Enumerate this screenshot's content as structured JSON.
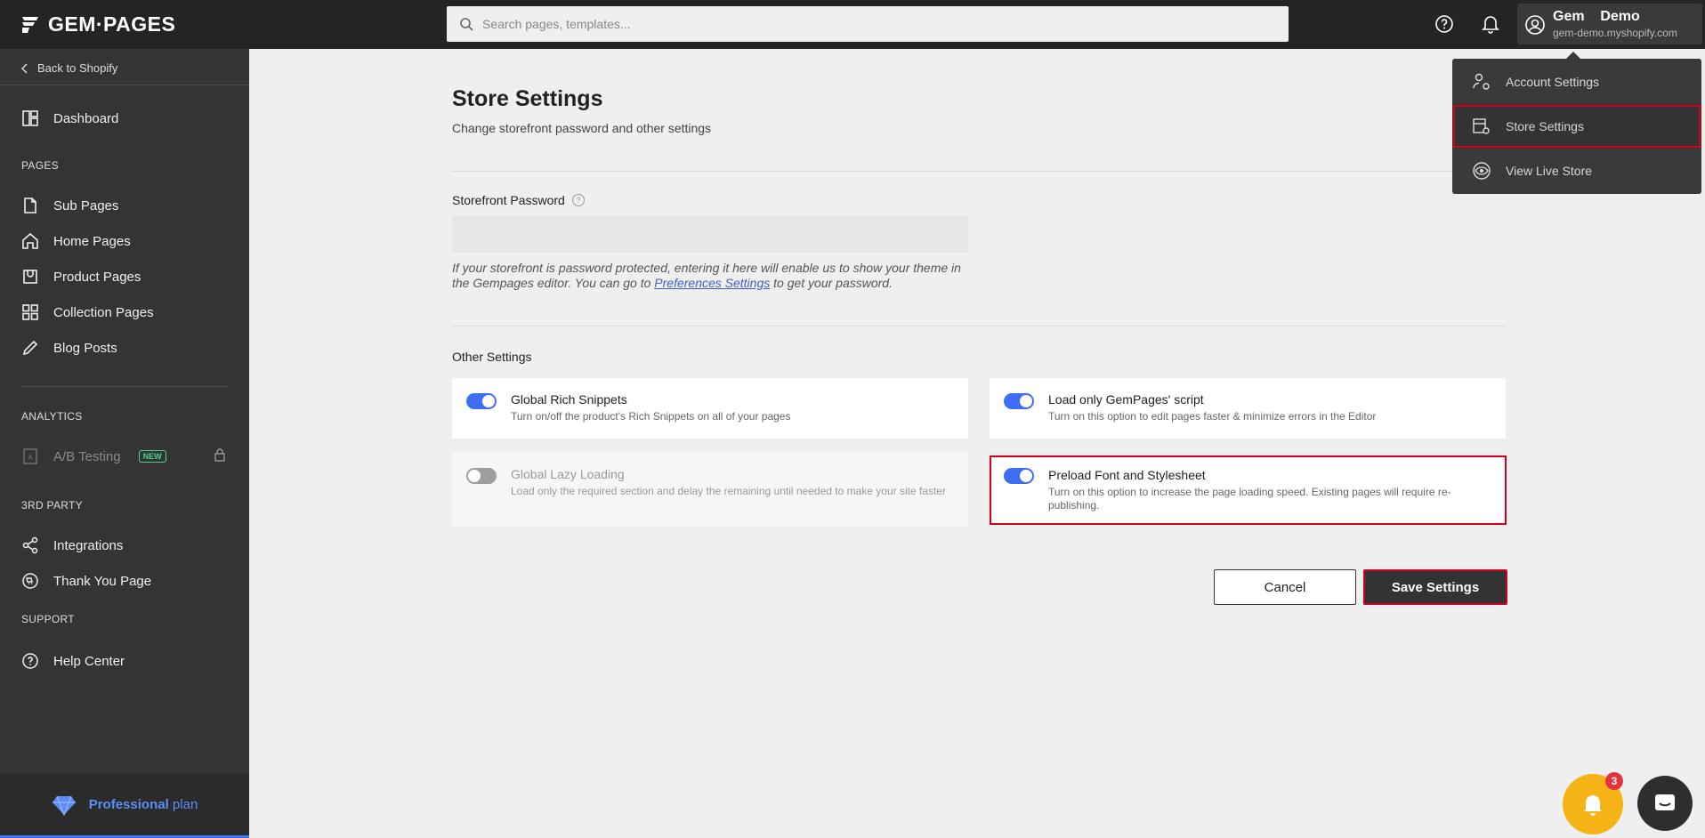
{
  "app": {
    "logo_text": "GEM·PAGES"
  },
  "search": {
    "placeholder": "Search pages, templates..."
  },
  "account": {
    "name": "Gem    Demo",
    "domain": "gem-demo.myshopify.com"
  },
  "sidebar": {
    "back": "Back to Shopify",
    "dashboard": "Dashboard",
    "sections": {
      "pages": "PAGES",
      "analytics": "ANALYTICS",
      "third_party": "3RD PARTY",
      "support": "SUPPORT"
    },
    "pages": [
      "Sub Pages",
      "Home Pages",
      "Product Pages",
      "Collection Pages",
      "Blog Posts"
    ],
    "ab_testing": "A/B Testing",
    "new_badge": "NEW",
    "integrations": "Integrations",
    "thank_you": "Thank You Page",
    "help_center": "Help Center",
    "plan": {
      "name": "Professional",
      "suffix": "plan"
    }
  },
  "main": {
    "title": "Store Settings",
    "subtitle": "Change storefront password and other settings",
    "password_label": "Storefront Password",
    "password_value": "",
    "hint_before": "If your storefront is password protected, entering it here will enable us to show your theme in the Gempages editor. You can go to ",
    "hint_link": "Preferences Settings",
    "hint_after": " to get your password.",
    "other_settings": "Other Settings",
    "options": [
      {
        "title": "Global Rich Snippets",
        "desc": "Turn on/off the product's Rich Snippets on all of your pages",
        "on": true
      },
      {
        "title": "Load only GemPages' script",
        "desc": "Turn on this option to edit pages faster & minimize errors in the Editor",
        "on": true
      },
      {
        "title": "Global Lazy Loading",
        "desc": "Load only the required section and delay the remaining until needed to make your site faster",
        "on": false
      },
      {
        "title": "Preload Font and Stylesheet",
        "desc": "Turn on this option to increase the page loading speed. Existing pages will require re-publishing.",
        "on": true
      }
    ],
    "cancel": "Cancel",
    "save": "Save Settings"
  },
  "dropdown": [
    "Account Settings",
    "Store Settings",
    "View Live Store"
  ],
  "notifications": {
    "count": "3"
  },
  "colors": {
    "accent": "#3d6ef3",
    "highlight": "#d0021b",
    "sidebar": "#343434"
  }
}
